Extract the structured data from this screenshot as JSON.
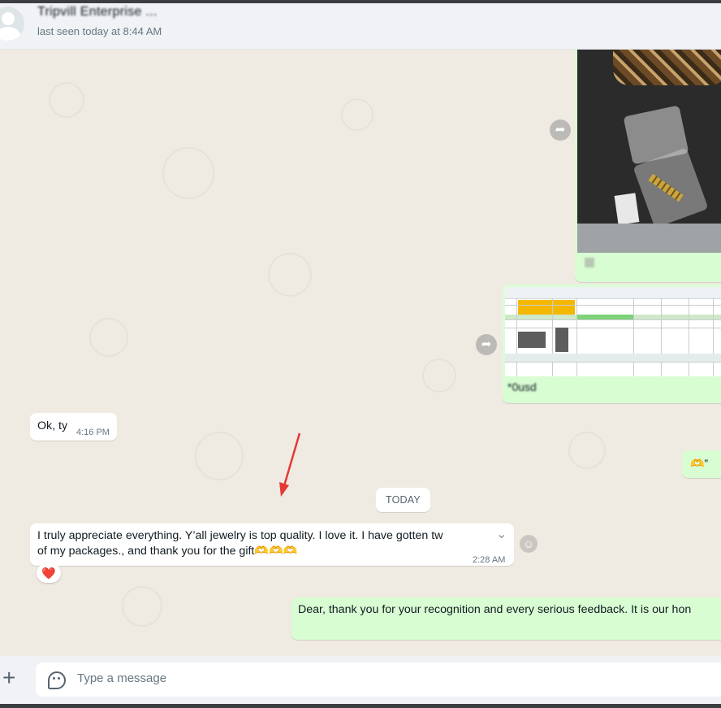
{
  "header": {
    "contact_name": "Tripvill Enterprise  ...",
    "last_seen": "last seen today at 8:44 AM"
  },
  "messages": {
    "ok_text": "Ok, ty",
    "ok_time": "4:16 PM",
    "out_emoji": "🫶”",
    "date_separator": "TODAY",
    "appreciation_line1": "I truly appreciate everything.  Y’all jewelry is top quality.  I love it. I have gotten tw",
    "appreciation_line2": "of my packages., and thank you for the gift🫶🫶🫶",
    "appreciation_time": "2:28 AM",
    "reaction": "❤️",
    "reply_text": "Dear, thank you for your recognition and every serious feedback. It is our hon",
    "image_caption_2": "*0usd"
  },
  "composer": {
    "placeholder": "Type a message",
    "plus_icon": "plus-icon",
    "sticker_icon": "sticker-icon"
  },
  "colors": {
    "chat_bg": "#efeae2",
    "incoming": "#ffffff",
    "outgoing": "#d9fdd3",
    "arrow": "#e53935"
  }
}
